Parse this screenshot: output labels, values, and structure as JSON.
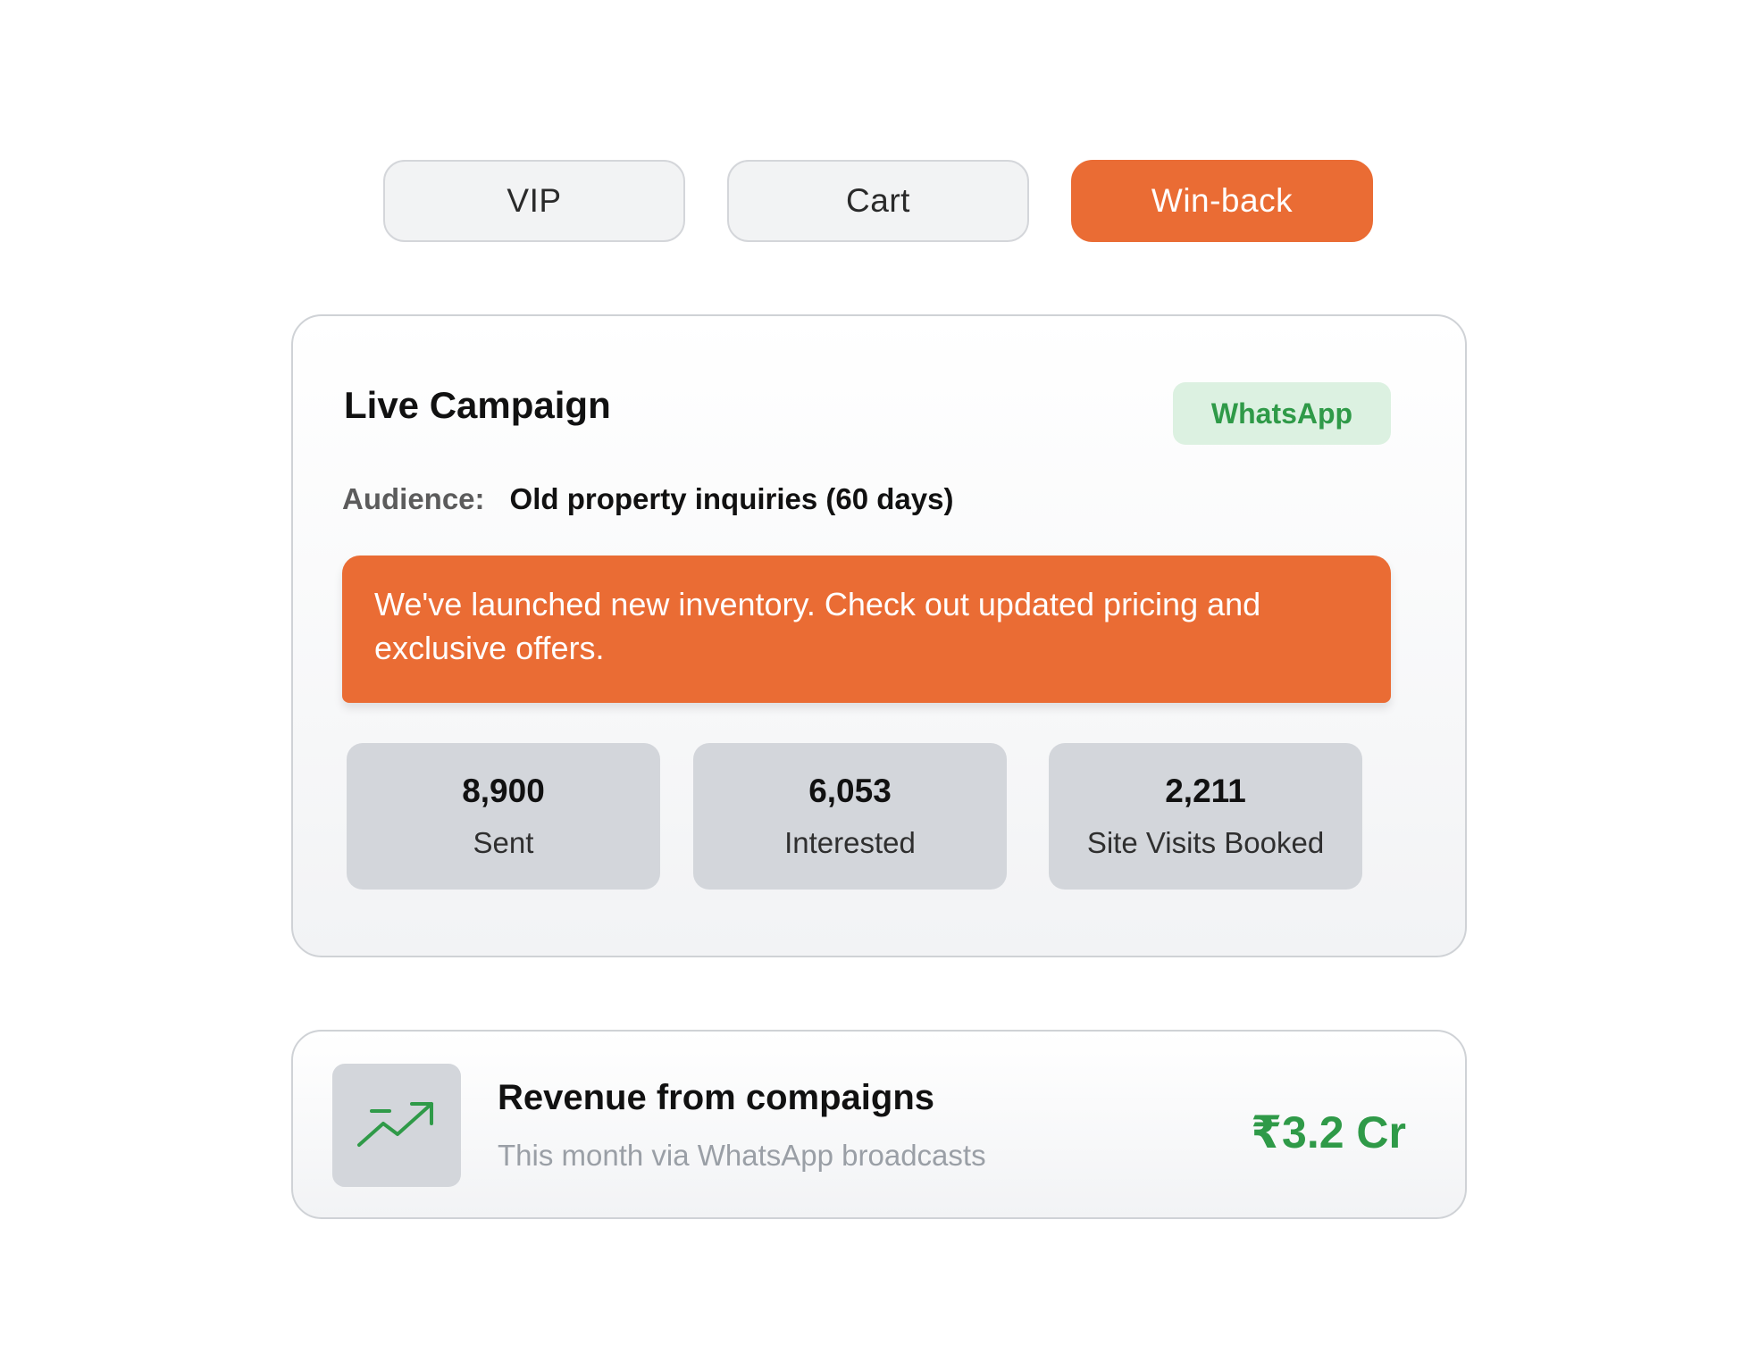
{
  "tabs": [
    {
      "label": "VIP",
      "active": false
    },
    {
      "label": "Cart",
      "active": false
    },
    {
      "label": "Win-back",
      "active": true
    }
  ],
  "campaign": {
    "title": "Live Campaign",
    "channel": "WhatsApp",
    "audience_label": "Audience:",
    "audience_value": "Old property inquiries (60 days)",
    "message": "We've launched new inventory. Check out updated pricing and exclusive offers.",
    "stats": [
      {
        "value": "8,900",
        "label": "Sent"
      },
      {
        "value": "6,053",
        "label": "Interested"
      },
      {
        "value": "2,211",
        "label": "Site Visits Booked"
      }
    ]
  },
  "revenue": {
    "icon": "trending-up-icon",
    "title": "Revenue from compaigns",
    "subtitle": "This month via WhatsApp broadcasts",
    "value": "₹3.2 Cr"
  },
  "colors": {
    "accent": "#ea6c34",
    "success": "#2f9a48",
    "badge_bg": "#dcf1e1",
    "tile_bg": "#d3d6db"
  }
}
